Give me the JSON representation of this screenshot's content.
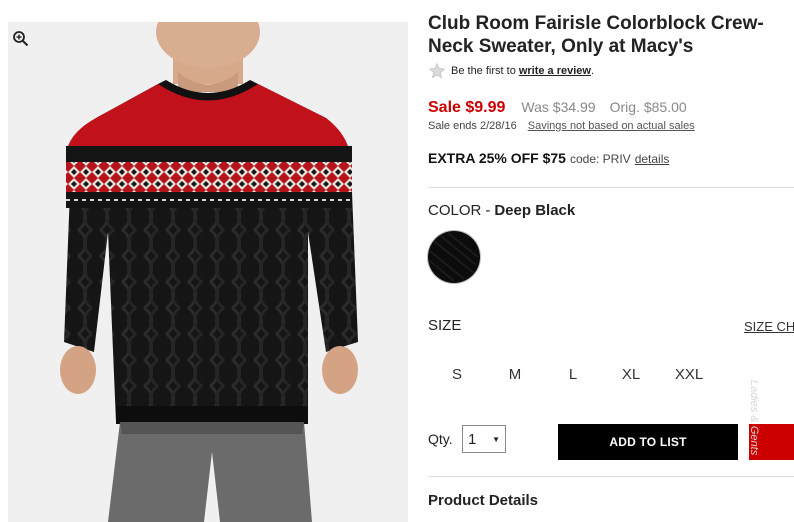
{
  "product": {
    "title_line1": "Club Room Fairisle Colorblock Crew-",
    "title_line2": "Neck Sweater, Only at Macy's"
  },
  "rating": {
    "prefix": "Be the first to",
    "link": "write a review",
    "suffix": "."
  },
  "price": {
    "sale": "Sale $9.99",
    "was": "Was $34.99",
    "orig": "Orig. $85.00",
    "sale_ends": "Sale ends 2/28/16",
    "note": "Savings not based on actual sales"
  },
  "promo": {
    "headline": "EXTRA 25% OFF $75",
    "code": "code: PRIV",
    "details": "details"
  },
  "color": {
    "label": "COLOR",
    "separator": "-",
    "value": "Deep Black"
  },
  "size": {
    "label": "SIZE",
    "chart_link": "SIZE CH",
    "options": [
      "S",
      "M",
      "L",
      "XL",
      "XXL"
    ]
  },
  "quantity": {
    "label": "Qty.",
    "value": "1"
  },
  "buttons": {
    "add_to_list": "ADD TO LIST"
  },
  "sections": {
    "product_details": "Product Details"
  },
  "watermark": "Ladies & Gents",
  "colors": {
    "sale_red": "#cc0000",
    "button_black": "#000000",
    "swatch": "#0c0c0c"
  }
}
